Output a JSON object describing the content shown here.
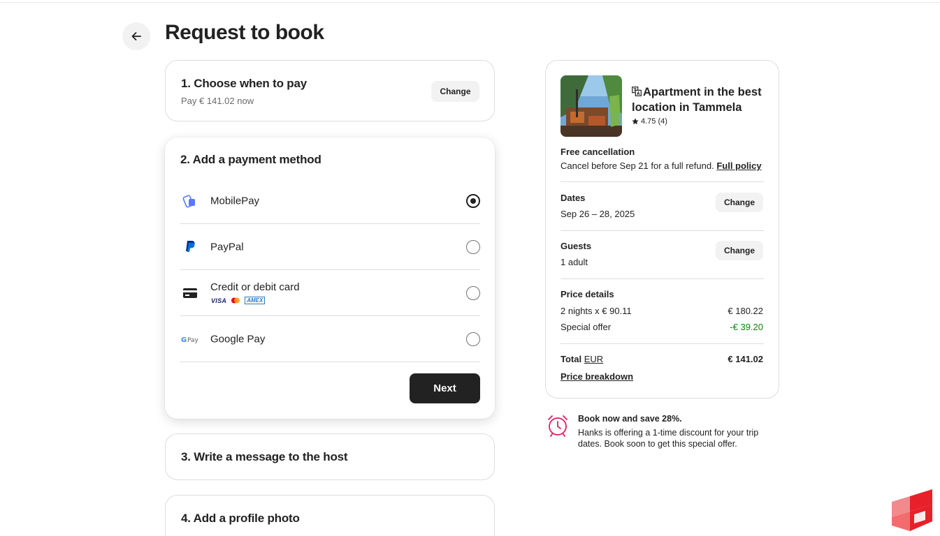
{
  "page": {
    "title": "Request to book"
  },
  "step1": {
    "title": "1. Choose when to pay",
    "subtitle": "Pay € 141.02 now",
    "change_label": "Change"
  },
  "step2": {
    "title": "2. Add a payment method",
    "options": [
      {
        "label": "MobilePay",
        "icon": "mobilepay-icon",
        "selected": true
      },
      {
        "label": "PayPal",
        "icon": "paypal-icon",
        "selected": false
      },
      {
        "label": "Credit or debit card",
        "icon": "credit-card-icon",
        "selected": false,
        "brands": [
          "VISA",
          "mastercard",
          "AMEX"
        ]
      },
      {
        "label": "Google Pay",
        "icon": "google-pay-icon",
        "selected": false
      }
    ],
    "next_label": "Next"
  },
  "step3": {
    "title": "3. Write a message to the host"
  },
  "step4": {
    "title": "4. Add a profile photo"
  },
  "summary": {
    "listing_title": "Apartment in the best location in Tammela",
    "rating": "4.75 (4)",
    "cancellation": {
      "title": "Free cancellation",
      "text": "Cancel before Sep 21 for a full refund.",
      "link": "Full policy"
    },
    "dates": {
      "label": "Dates",
      "value": "Sep 26 – 28, 2025",
      "change_label": "Change"
    },
    "guests": {
      "label": "Guests",
      "value": "1 adult",
      "change_label": "Change"
    },
    "price_details": {
      "title": "Price details",
      "lines": [
        {
          "label": "2 nights x € 90.11",
          "value": "€ 180.22"
        },
        {
          "label": "Special offer",
          "value": "-€ 39.20"
        }
      ],
      "total_label": "Total",
      "currency": "EUR",
      "total_value": "€ 141.02",
      "breakdown_link": "Price breakdown"
    }
  },
  "promo": {
    "title": "Book now and save 28%.",
    "text": "Hanks is offering a 1-time discount for your trip dates. Book soon to get this special offer."
  },
  "colors": {
    "accent": "#222222",
    "discount_green": "#008a05",
    "promo_pink": "#e31c5f"
  }
}
